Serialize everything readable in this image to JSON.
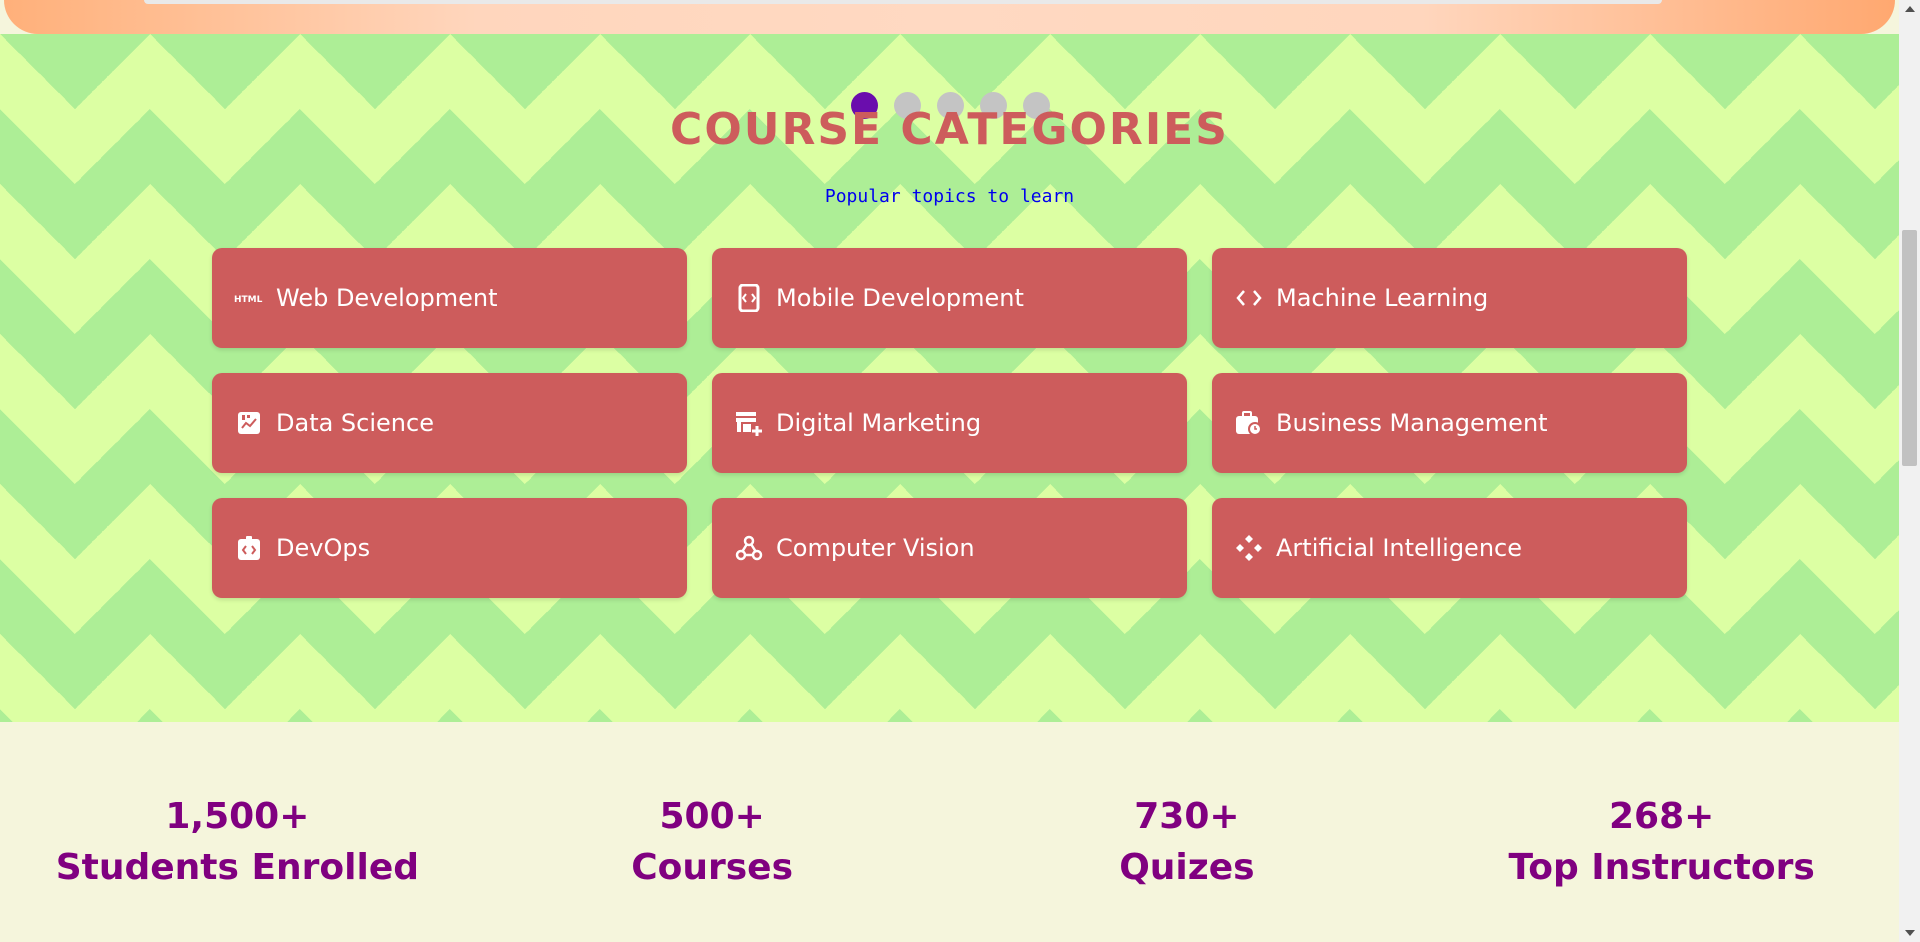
{
  "carousel": {
    "dots": 5,
    "active_index": 0
  },
  "section": {
    "title": "COURSE CATEGORIES",
    "subtitle": "Popular topics to learn"
  },
  "categories": [
    {
      "label": "Web Development",
      "icon": "html-icon"
    },
    {
      "label": "Mobile Development",
      "icon": "mobile-code-icon"
    },
    {
      "label": "Machine Learning",
      "icon": "code-brackets-icon"
    },
    {
      "label": "Data Science",
      "icon": "analytics-icon"
    },
    {
      "label": "Digital Marketing",
      "icon": "storefront-add-icon"
    },
    {
      "label": "Business Management",
      "icon": "business-center-icon"
    },
    {
      "label": "DevOps",
      "icon": "developer-board-icon"
    },
    {
      "label": "Computer Vision",
      "icon": "webhook-icon"
    },
    {
      "label": "Artificial Intelligence",
      "icon": "network-diamond-icon"
    }
  ],
  "stats": [
    {
      "value": "1,500+",
      "label": "Students Enrolled"
    },
    {
      "value": "500+",
      "label": "Courses"
    },
    {
      "value": "730+",
      "label": "Quizes"
    },
    {
      "value": "268+",
      "label": "Top Instructors"
    }
  ],
  "colors": {
    "card": "#cd5c5c",
    "title": "#cd5c5c",
    "subtitle": "#0000ee",
    "stat_text": "#800080",
    "dot_active": "#6a0dad",
    "dot_inactive": "#c4c4c4",
    "zig_light": "#dcffa3",
    "zig_dark": "#adee96"
  }
}
